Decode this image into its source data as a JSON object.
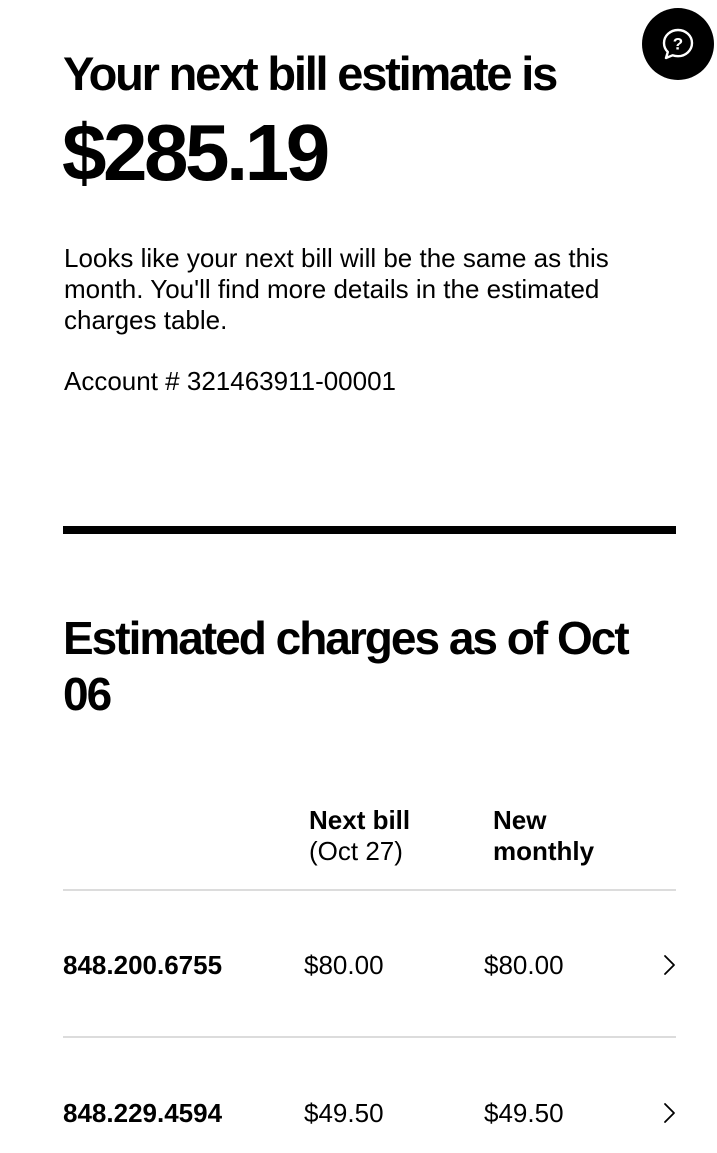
{
  "help": {
    "icon": "help-chat-icon"
  },
  "estimate": {
    "headline": "Your next bill estimate is",
    "amount": "$285.19",
    "description": "Looks like your next bill will be the same as this month. You'll find more details in the estimated charges table.",
    "account": "Account # 321463911-00001"
  },
  "charges": {
    "title": "Estimated charges as of Oct 06",
    "columns": {
      "next_bill_label": "Next bill",
      "next_bill_date": "(Oct 27)",
      "new_monthly_line1": "New",
      "new_monthly_line2": "monthly"
    },
    "rows": [
      {
        "line": "848.200.6755",
        "next_bill": "$80.00",
        "new_monthly": "$80.00"
      },
      {
        "line": "848.229.4594",
        "next_bill": "$49.50",
        "new_monthly": "$49.50"
      }
    ]
  }
}
